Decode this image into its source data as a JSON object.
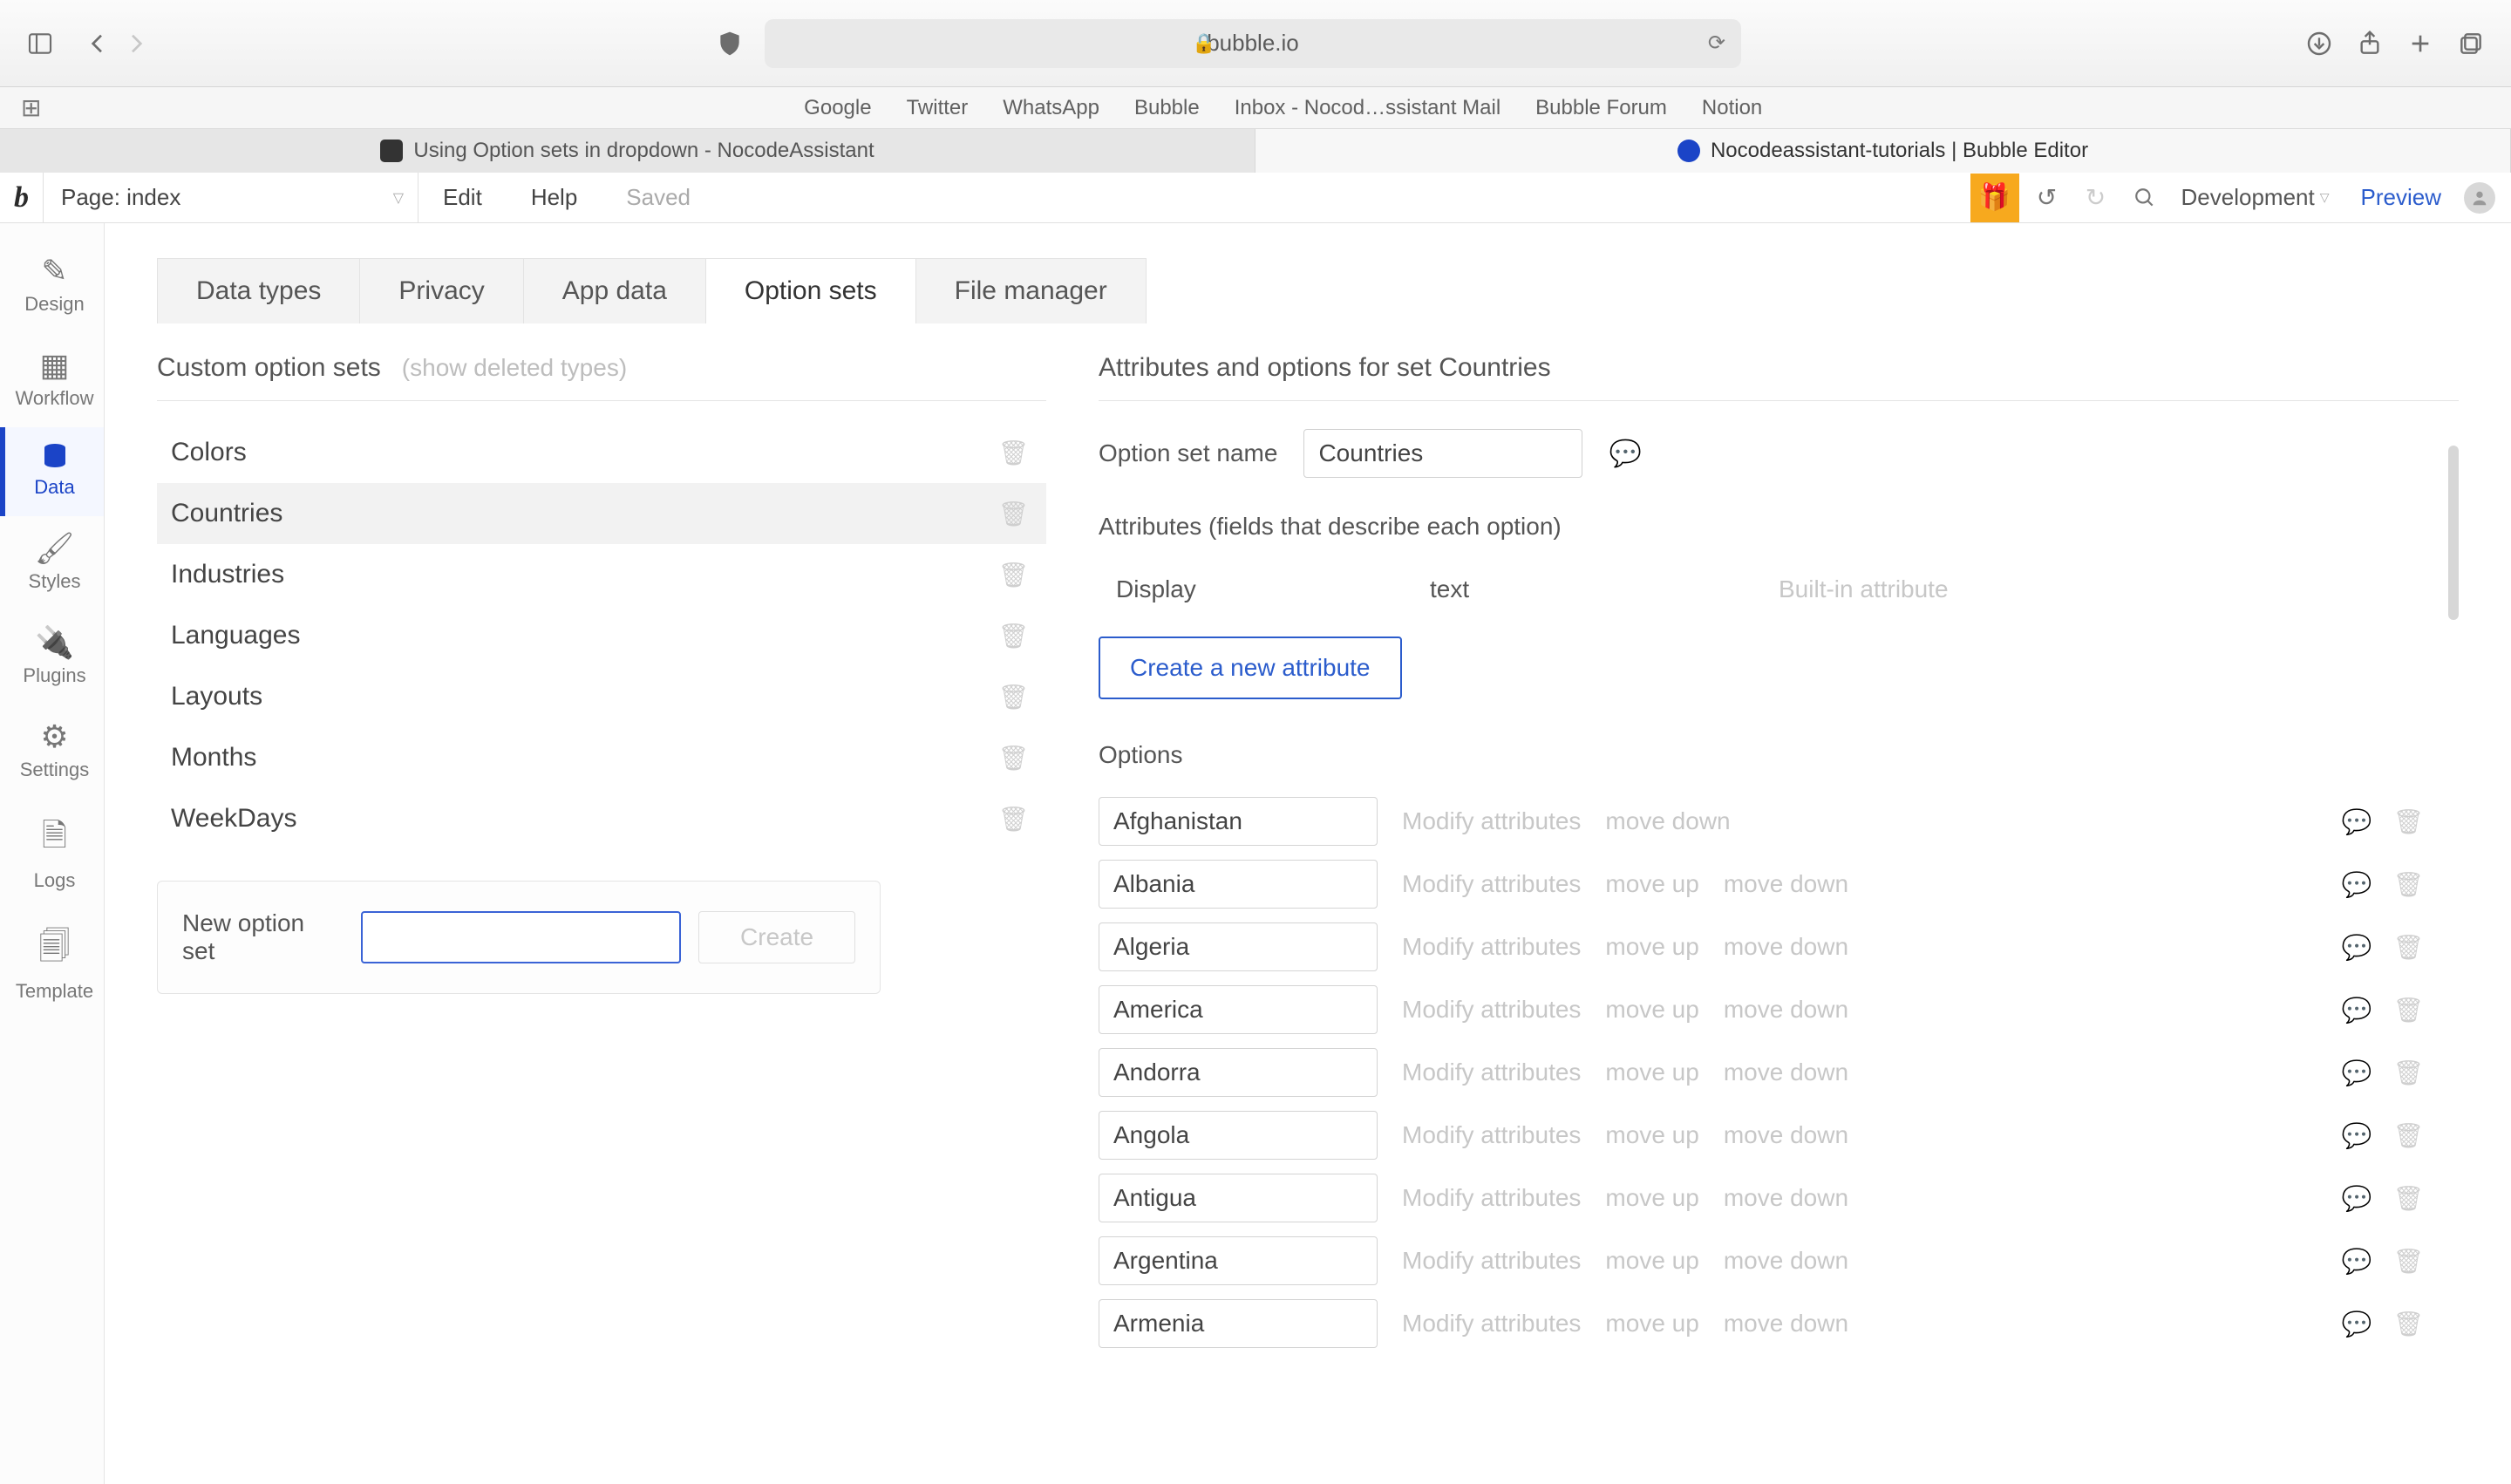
{
  "safari": {
    "url_display": "bubble.io",
    "bookmarks": [
      "Google",
      "Twitter",
      "WhatsApp",
      "Bubble",
      "Inbox - Nocod…ssistant Mail",
      "Bubble Forum",
      "Notion"
    ]
  },
  "browser_tabs": {
    "background": "Using Option sets in dropdown - NocodeAssistant",
    "foreground": "Nocodeassistant-tutorials | Bubble Editor"
  },
  "bubble_header": {
    "page_label": "Page: index",
    "edit": "Edit",
    "help": "Help",
    "saved": "Saved",
    "development": "Development",
    "preview": "Preview"
  },
  "sidebar": {
    "items": [
      {
        "label": "Design"
      },
      {
        "label": "Workflow"
      },
      {
        "label": "Data"
      },
      {
        "label": "Styles"
      },
      {
        "label": "Plugins"
      },
      {
        "label": "Settings"
      },
      {
        "label": "Logs"
      },
      {
        "label": "Template"
      }
    ]
  },
  "data_tabs": [
    "Data types",
    "Privacy",
    "App data",
    "Option sets",
    "File manager"
  ],
  "left_panel": {
    "title": "Custom option sets",
    "show_deleted": "(show deleted types)",
    "sets": [
      "Colors",
      "Countries",
      "Industries",
      "Languages",
      "Layouts",
      "Months",
      "WeekDays"
    ],
    "selected": "Countries",
    "new_label": "New option set",
    "create_btn": "Create"
  },
  "right_panel": {
    "title": "Attributes and options for set Countries",
    "name_label": "Option set name",
    "name_value": "Countries",
    "attrs_head": "Attributes (fields that describe each option)",
    "display_field": {
      "name": "Display",
      "type": "text",
      "note": "Built-in attribute"
    },
    "new_attr_btn": "Create a new attribute",
    "options_head": "Options",
    "modify": "Modify attributes",
    "move_up": "move up",
    "move_down": "move down",
    "options": [
      {
        "name": "Afghanistan",
        "up": false,
        "down": true
      },
      {
        "name": "Albania",
        "up": true,
        "down": true
      },
      {
        "name": "Algeria",
        "up": true,
        "down": true
      },
      {
        "name": "America",
        "up": true,
        "down": true
      },
      {
        "name": "Andorra",
        "up": true,
        "down": true
      },
      {
        "name": "Angola",
        "up": true,
        "down": true
      },
      {
        "name": "Antigua",
        "up": true,
        "down": true
      },
      {
        "name": "Argentina",
        "up": true,
        "down": true
      },
      {
        "name": "Armenia",
        "up": true,
        "down": true
      }
    ]
  }
}
